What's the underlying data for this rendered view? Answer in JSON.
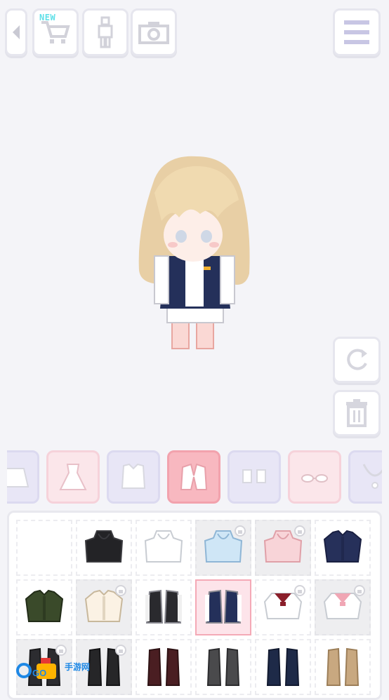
{
  "toolbar": {
    "new_badge": "NEW",
    "back_icon": "chevron-left-icon",
    "shop_icon": "shopping-cart-icon",
    "body_icon": "body-silhouette-icon",
    "camera_icon": "camera-icon",
    "menu_icon": "hamburger-menu-icon"
  },
  "side_actions": [
    "rotate-icon",
    "trash-icon"
  ],
  "categories": [
    {
      "icon": "skirt-icon",
      "style": "lav"
    },
    {
      "icon": "dress-icon",
      "style": "pink"
    },
    {
      "icon": "top-icon",
      "style": "lav"
    },
    {
      "icon": "jacket-icon",
      "style": "selected"
    },
    {
      "icon": "socks-icon",
      "style": "lav"
    },
    {
      "icon": "glasses-icon",
      "style": "pink"
    },
    {
      "icon": "necklace-icon",
      "style": "lav"
    }
  ],
  "items": [
    {
      "name": "empty-slot",
      "style": "plain",
      "locked": false
    },
    {
      "name": "black-hoodie",
      "style": "plain",
      "locked": false
    },
    {
      "name": "white-hoodie",
      "style": "plain",
      "locked": false
    },
    {
      "name": "light-blue-hoodie",
      "style": "grey",
      "locked": true
    },
    {
      "name": "pink-hoodie",
      "style": "grey",
      "locked": true
    },
    {
      "name": "navy-sweater",
      "style": "plain",
      "locked": false
    },
    {
      "name": "olive-cardigan",
      "style": "plain",
      "locked": false
    },
    {
      "name": "cream-cardigan",
      "style": "grey",
      "locked": true
    },
    {
      "name": "black-open-jacket",
      "style": "plain",
      "locked": false
    },
    {
      "name": "navy-varsity-jacket",
      "style": "selected",
      "locked": false
    },
    {
      "name": "sailor-top-red",
      "style": "plain",
      "locked": true
    },
    {
      "name": "sailor-top-pink",
      "style": "grey",
      "locked": true
    },
    {
      "name": "dark-long-coat",
      "style": "grey",
      "locked": true
    },
    {
      "name": "black-long-coat",
      "style": "grey",
      "locked": true
    },
    {
      "name": "burgundy-long-coat",
      "style": "plain",
      "locked": false
    },
    {
      "name": "grey-long-coat",
      "style": "plain",
      "locked": false
    },
    {
      "name": "navy-long-coat",
      "style": "plain",
      "locked": false
    },
    {
      "name": "tan-long-coat",
      "style": "plain",
      "locked": false
    }
  ],
  "watermark": {
    "brand": "GO",
    "text": "手游网"
  },
  "colors": {
    "accent": "#f8b8c0",
    "background": "#f4f4f8",
    "lavender": "#e8e6f6"
  }
}
